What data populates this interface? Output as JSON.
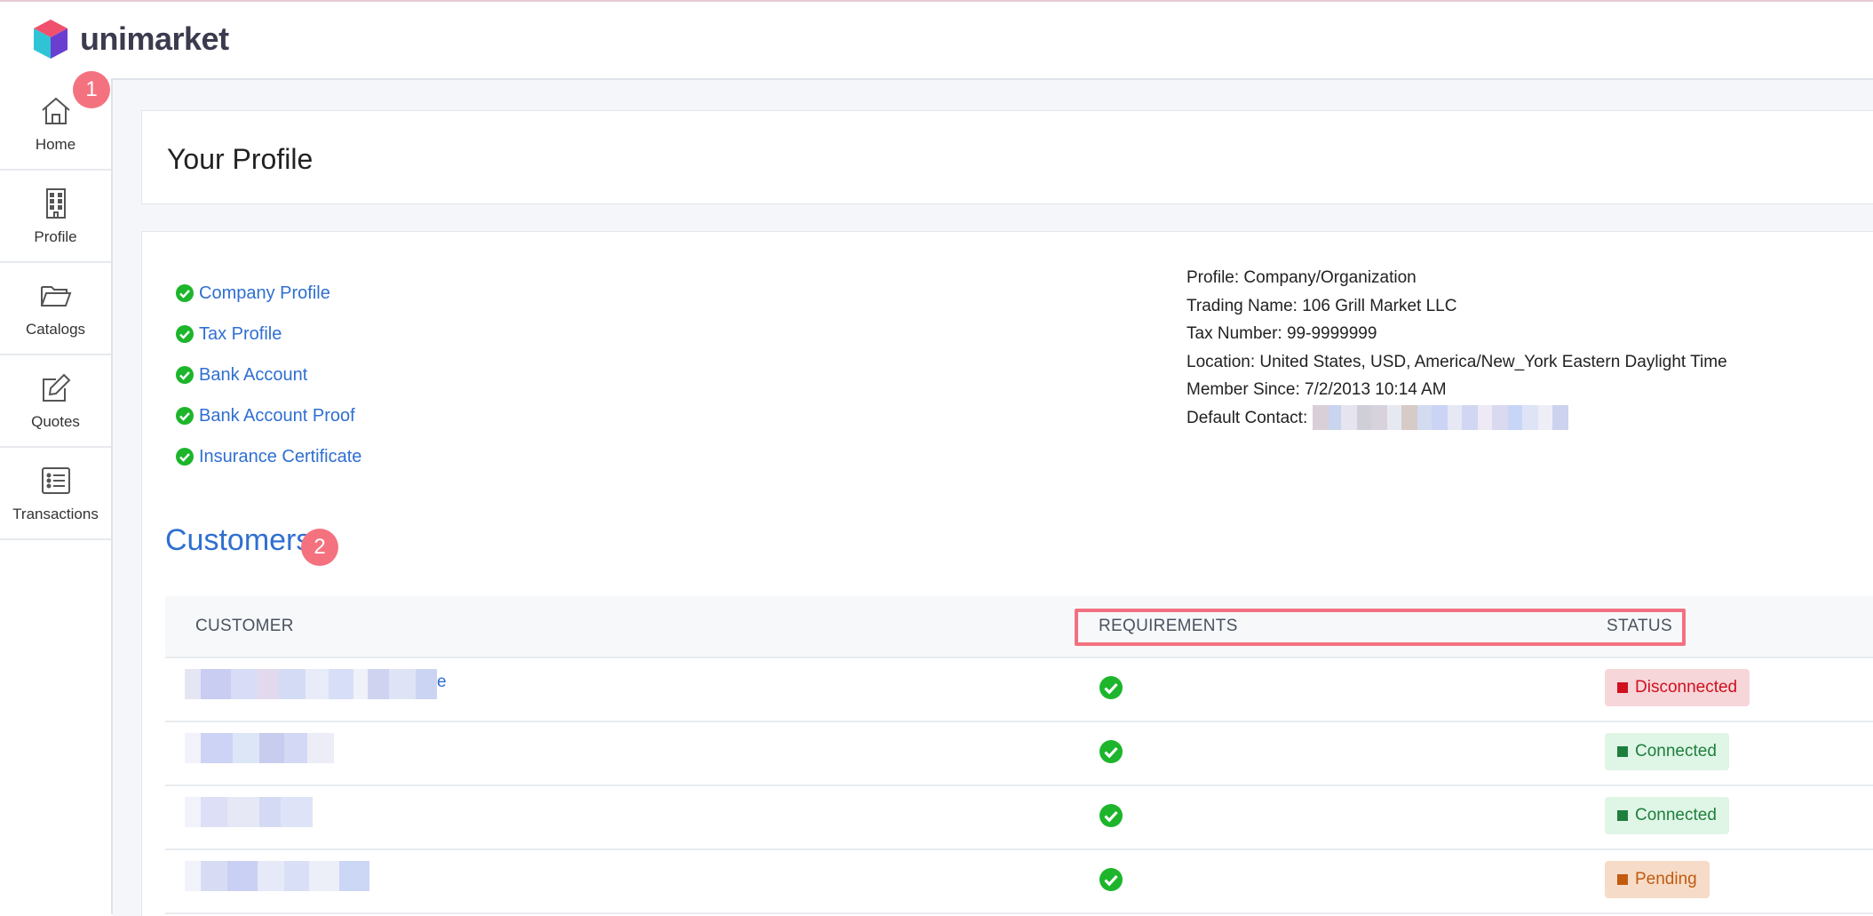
{
  "brand": {
    "name": "unimarket"
  },
  "sidebar": {
    "items": [
      {
        "label": "Home",
        "icon": "home-icon"
      },
      {
        "label": "Profile",
        "icon": "building-icon"
      },
      {
        "label": "Catalogs",
        "icon": "folder-icon"
      },
      {
        "label": "Quotes",
        "icon": "edit-icon"
      },
      {
        "label": "Transactions",
        "icon": "list-icon"
      }
    ],
    "badge": "1"
  },
  "page": {
    "title": "Your Profile"
  },
  "requirements": [
    {
      "label": "Company Profile"
    },
    {
      "label": "Tax Profile"
    },
    {
      "label": "Bank Account"
    },
    {
      "label": "Bank Account Proof"
    },
    {
      "label": "Insurance Certificate"
    }
  ],
  "profile_info": {
    "profile": "Profile: Company/Organization",
    "trading_name": "Trading Name: 106 Grill Market LLC",
    "tax_number": "Tax Number: 99-9999999",
    "location": "Location: United States, USD, America/New_York Eastern Daylight Time",
    "member_since": "Member Since: 7/2/2013 10:14 AM",
    "default_contact": "Default Contact:"
  },
  "customers": {
    "title": "Customers",
    "badge": "2",
    "headers": {
      "customer": "CUSTOMER",
      "requirements": "REQUIREMENTS",
      "status": "STATUS"
    },
    "rows": [
      {
        "name_tail": "e",
        "status": "Disconnected",
        "status_type": "disconnected"
      },
      {
        "name_tail": "",
        "status": "Connected",
        "status_type": "connected"
      },
      {
        "name_tail": "",
        "status": "Connected",
        "status_type": "connected"
      },
      {
        "name_tail": "",
        "status": "Pending",
        "status_type": "pending"
      }
    ]
  },
  "colors": {
    "link": "#2f6fd1",
    "check": "#1db52b",
    "badge": "#f4727f",
    "disconnected": "#d0101e",
    "connected": "#1e7f3c",
    "pending": "#c25a10"
  }
}
